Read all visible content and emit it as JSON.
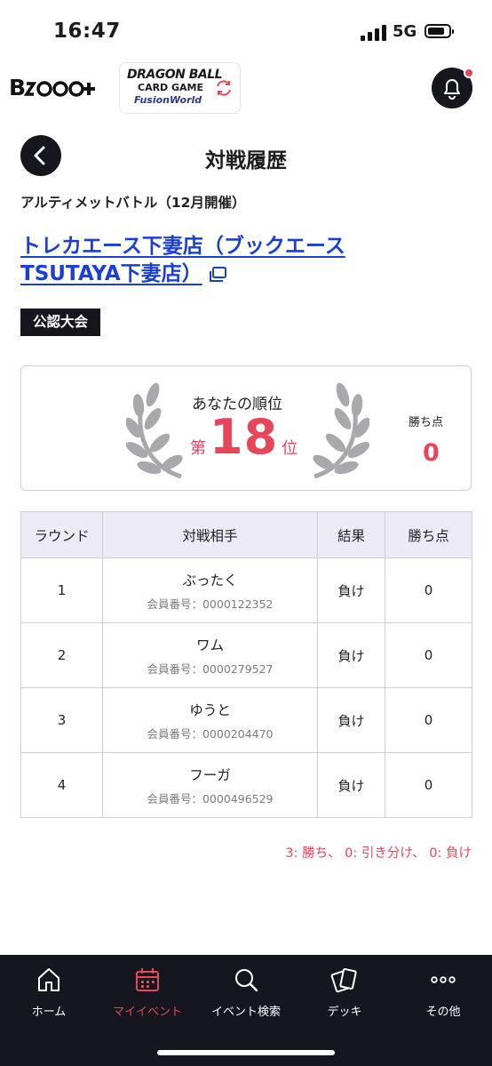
{
  "status_bar": {
    "time": "16:47",
    "network": "5G"
  },
  "header": {
    "brand_logo": "Bキズ+",
    "game_logo_line1": "DRAGON BALL",
    "game_logo_line2": "CARD GAME",
    "game_logo_line3": "FusionWorld",
    "icons": {
      "switch": "swap-icon",
      "notification": "bell-icon"
    }
  },
  "page": {
    "title": "対戦履歴",
    "back_icon": "chevron-left-icon"
  },
  "event": {
    "name": "アルティメットバトル（12月開催）",
    "venue": "トレカエース下妻店（ブックエースTSUTAYA下妻店）",
    "badge": "公認大会"
  },
  "rank": {
    "label": "あなたの順位",
    "prefix": "第",
    "value": "18",
    "suffix": "位",
    "points_label": "勝ち点",
    "points_value": "0"
  },
  "table": {
    "headers": [
      "ラウンド",
      "対戦相手",
      "結果",
      "勝ち点"
    ],
    "rows": [
      {
        "round": "1",
        "opponent": "ぶったく",
        "member_id": "会員番号：0000122352",
        "result": "負け",
        "points": "0"
      },
      {
        "round": "2",
        "opponent": "ワム",
        "member_id": "会員番号：0000279527",
        "result": "負け",
        "points": "0"
      },
      {
        "round": "3",
        "opponent": "ゆうと",
        "member_id": "会員番号：0000204470",
        "result": "負け",
        "points": "0"
      },
      {
        "round": "4",
        "opponent": "フーガ",
        "member_id": "会員番号：0000496529",
        "result": "負け",
        "points": "0"
      }
    ]
  },
  "legend": "3: 勝ち、 0: 引き分け、 0: 負け",
  "tabbar": {
    "items": [
      {
        "label": "ホーム",
        "icon": "home-icon"
      },
      {
        "label": "マイイベント",
        "icon": "calendar-icon",
        "active": true
      },
      {
        "label": "イベント検索",
        "icon": "search-icon"
      },
      {
        "label": "デッキ",
        "icon": "cards-icon"
      },
      {
        "label": "その他",
        "icon": "more-icon"
      }
    ]
  },
  "colors": {
    "accent": "#e8455a",
    "link": "#1a3fd6",
    "dark": "#16161e",
    "table_header_bg": "#eceaf5"
  }
}
